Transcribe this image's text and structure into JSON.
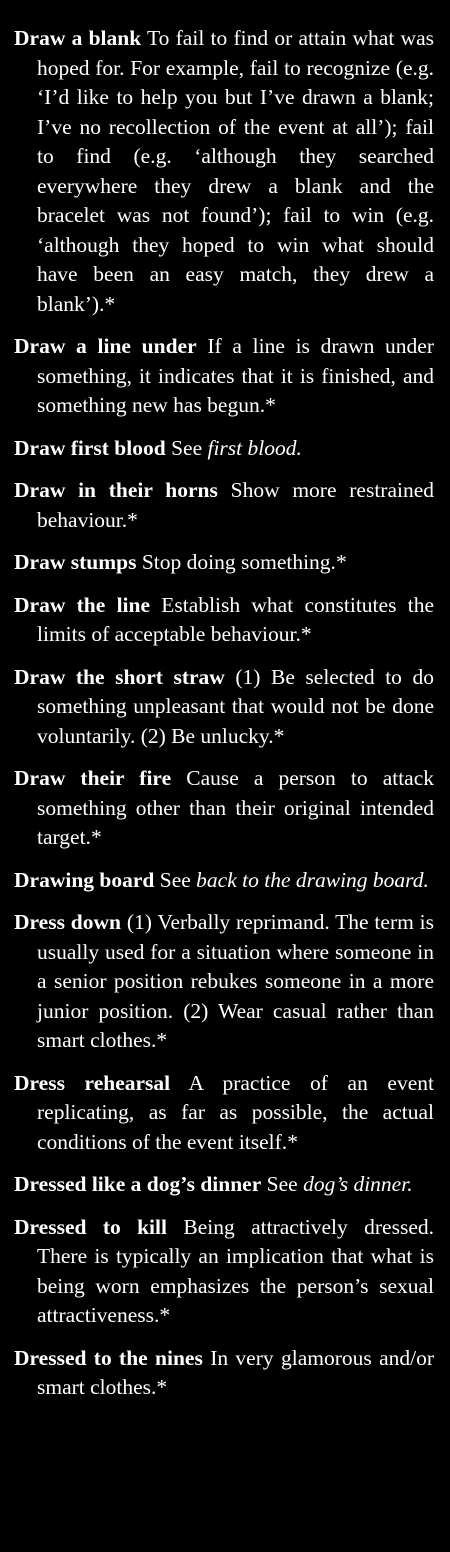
{
  "entries": [
    {
      "term": "Draw a blank",
      "definition": "To fail to find or attain what was hoped for. For example, fail to recognize (e.g. ‘I’d like to help you but I’ve drawn a blank; I’ve no recollection of the event at all’); fail to find (e.g. ‘although they searched everywhere they drew a blank and the bracelet was not found’); fail to win (e.g. ‘although they hoped to win what should have been an easy match, they drew a blank’).",
      "marker": "*"
    },
    {
      "term": "Draw a line under",
      "definition": "If a line is drawn under something, it indicates that it is finished, and something new has begun.",
      "marker": "*"
    },
    {
      "term": "Draw first blood",
      "see": "See",
      "ref": "first blood."
    },
    {
      "term": "Draw in their horns",
      "definition": "Show more restrained behaviour.",
      "marker": "*"
    },
    {
      "term": "Draw stumps",
      "definition": "Stop doing something.",
      "marker": "*"
    },
    {
      "term": "Draw the line",
      "definition": "Establish what constitutes the limits of acceptable behaviour.",
      "marker": "*"
    },
    {
      "term": "Draw the short straw",
      "definition": "(1) Be selected to do something unpleasant that would not be done voluntarily. (2) Be unlucky.",
      "marker": "*"
    },
    {
      "term": "Draw their fire",
      "definition": "Cause a person to attack something other than their original intended target.",
      "marker": "*"
    },
    {
      "term": "Drawing board",
      "see": "See",
      "ref": "back to the drawing board."
    },
    {
      "term": "Dress down",
      "definition": "(1) Verbally reprimand. The term is usually used for a situation where someone in a senior position rebukes someone in a more junior position. (2) Wear casual rather than smart clothes.",
      "marker": "*"
    },
    {
      "term": "Dress rehearsal",
      "definition": "A practice of an event replicating, as far as possible, the actual conditions of the event itself.",
      "marker": "*"
    },
    {
      "term": "Dressed like a dog’s dinner",
      "see": "See",
      "ref": "dog’s dinner."
    },
    {
      "term": "Dressed to kill",
      "definition": "Being attractively dressed. There is typically an implication that what is being worn emphasizes the person’s sexual attractiveness.",
      "marker": "*"
    },
    {
      "term": "Dressed to the nines",
      "definition": "In very glamorous and/or smart clothes.",
      "marker": "*"
    }
  ]
}
